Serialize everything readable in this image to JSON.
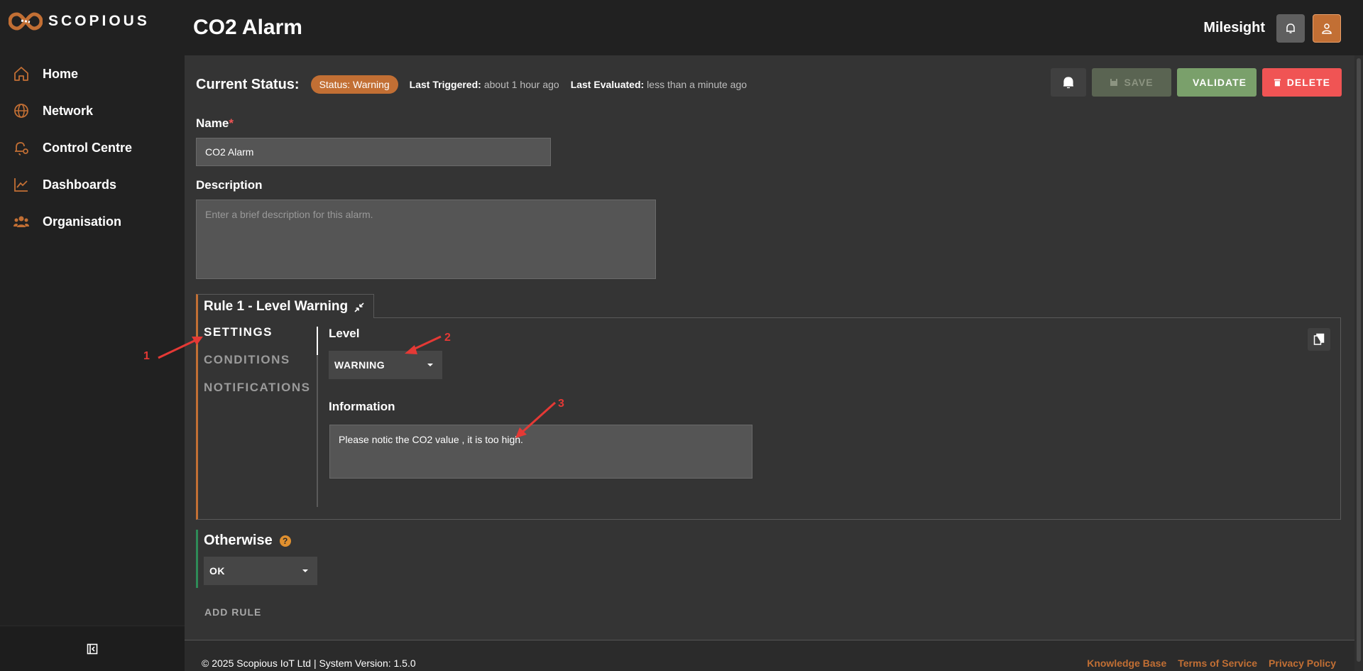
{
  "brand": {
    "name": "SCOPIOUS",
    "accent": "#c26f34"
  },
  "sidebar": {
    "items": [
      {
        "label": "Home",
        "icon": "home-icon"
      },
      {
        "label": "Network",
        "icon": "globe-icon"
      },
      {
        "label": "Control Centre",
        "icon": "bell-gear-icon"
      },
      {
        "label": "Dashboards",
        "icon": "line-chart-icon"
      },
      {
        "label": "Organisation",
        "icon": "users-icon"
      }
    ],
    "collapse_icon": "collapse-sidebar-icon"
  },
  "header": {
    "title": "CO2 Alarm",
    "org": "Milesight"
  },
  "status": {
    "heading": "Current Status:",
    "badge": "Status: Warning",
    "triggered_label": "Last Triggered:",
    "triggered_value": "about 1 hour ago",
    "evaluated_label": "Last Evaluated:",
    "evaluated_value": "less than a minute ago"
  },
  "actions": {
    "save": "SAVE",
    "validate": "VALIDATE",
    "delete": "DELETE"
  },
  "form": {
    "name_label": "Name",
    "name_required": "*",
    "name_value": "CO2 Alarm",
    "description_label": "Description",
    "description_placeholder": "Enter a brief description for this alarm."
  },
  "rule": {
    "title": "Rule 1 - Level Warning",
    "tabs": [
      "SETTINGS",
      "CONDITIONS",
      "NOTIFICATIONS"
    ],
    "active_tab": "SETTINGS",
    "level_label": "Level",
    "level_value": "WARNING",
    "information_label": "Information",
    "information_value": "Please notic the CO2 value , it is too high."
  },
  "otherwise": {
    "title": "Otherwise",
    "help": "?",
    "value": "OK"
  },
  "add_rule": "ADD RULE",
  "footer": {
    "copyright": "© 2025 Scopious IoT Ltd | System Version: 1.5.0",
    "links": [
      "Knowledge Base",
      "Terms of Service",
      "Privacy Policy"
    ]
  },
  "annotations": {
    "one": "1",
    "two": "2",
    "three": "3"
  }
}
